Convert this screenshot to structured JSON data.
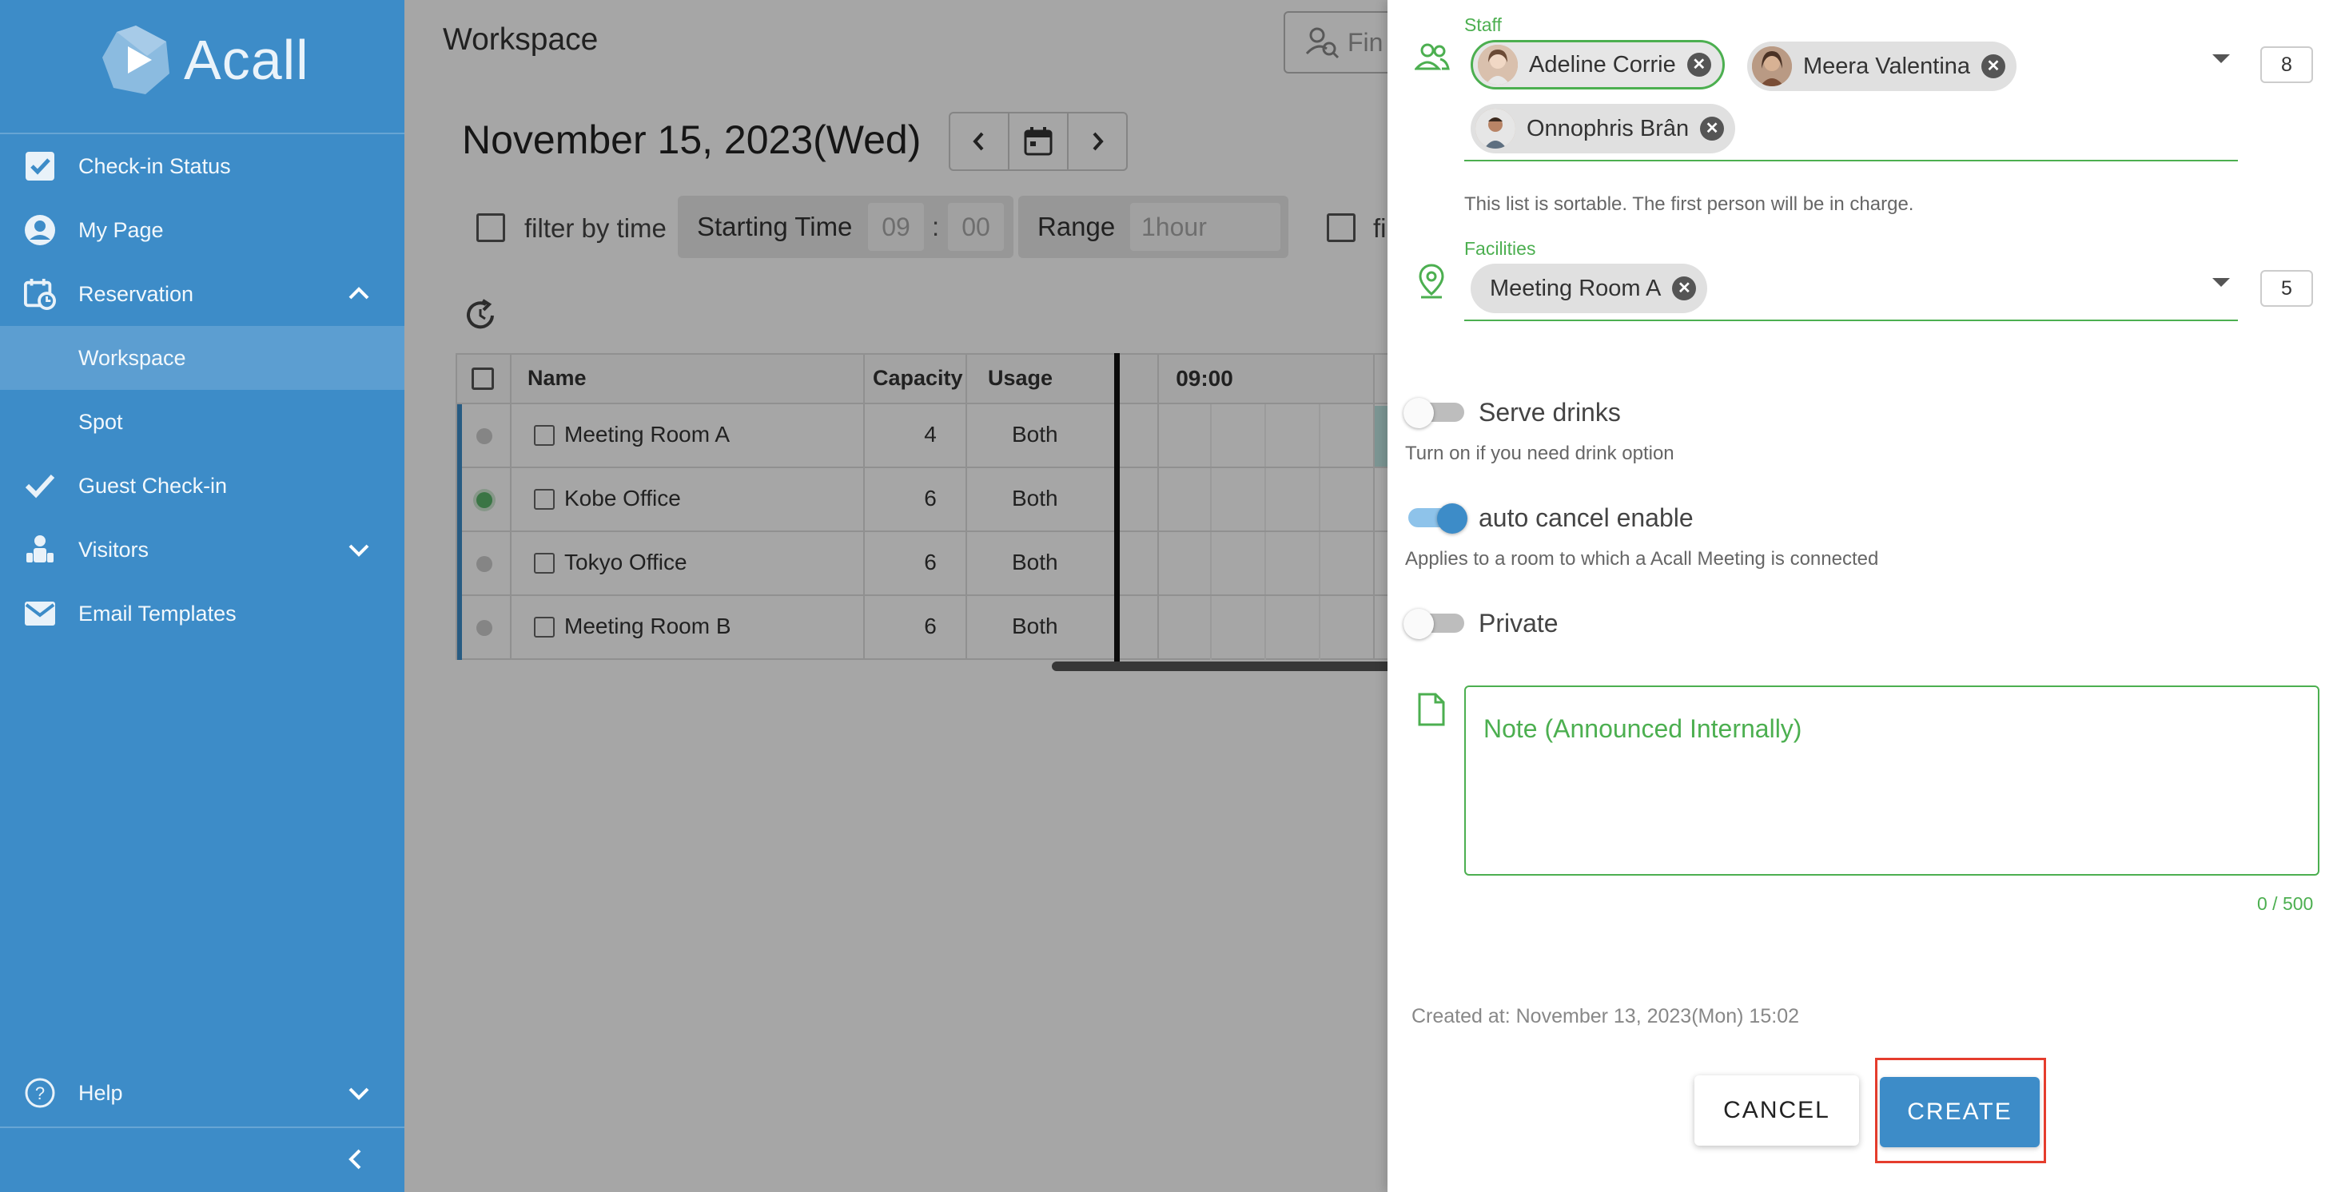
{
  "sidebar": {
    "brand": "Acall",
    "items": [
      {
        "label": "Check-in Status",
        "icon": "check-square-icon"
      },
      {
        "label": "My Page",
        "icon": "account-circle-icon"
      },
      {
        "label": "Reservation",
        "icon": "calendar-clock-icon"
      },
      {
        "label": "Workspace"
      },
      {
        "label": "Spot"
      },
      {
        "label": "Guest Check-in",
        "icon": "checkmark-icon"
      },
      {
        "label": "Visitors",
        "icon": "visitor-icon"
      },
      {
        "label": "Email Templates",
        "icon": "mail-icon"
      }
    ],
    "help": "Help"
  },
  "main": {
    "title": "Workspace",
    "search_placeholder": "Fin",
    "date": "November 15, 2023(Wed)",
    "filter": {
      "filter_by_time": "filter by time",
      "starting_time_label": "Starting Time",
      "hour": "09",
      "sep": ":",
      "minute": "00",
      "range_label": "Range",
      "range_value": "1hour",
      "cut_label": "fi"
    },
    "table": {
      "headers": {
        "name": "Name",
        "capacity": "Capacity",
        "usage": "Usage",
        "time": "09:00"
      },
      "rows": [
        {
          "name": "Meeting Room A",
          "capacity": "4",
          "usage": "Both"
        },
        {
          "name": "Kobe Office",
          "capacity": "6",
          "usage": "Both"
        },
        {
          "name": "Tokyo Office",
          "capacity": "6",
          "usage": "Both"
        },
        {
          "name": "Meeting Room B",
          "capacity": "6",
          "usage": "Both"
        }
      ]
    }
  },
  "panel": {
    "staff_label": "Staff",
    "staff": [
      "Adeline Corrie",
      "Meera Valentina",
      "Onnophris Brân"
    ],
    "staff_count": "8",
    "staff_hint": "This list is sortable. The first person will be in charge.",
    "facilities_label": "Facilities",
    "facilities": [
      "Meeting Room A"
    ],
    "facilities_count": "5",
    "serve_drinks": {
      "label": "Serve drinks",
      "hint": "Turn on if you need drink option",
      "on": false
    },
    "auto_cancel": {
      "label": "auto cancel enable",
      "hint": "Applies to a room to which a Acall Meeting is connected",
      "on": true
    },
    "private": {
      "label": "Private",
      "on": false
    },
    "note_placeholder": "Note (Announced Internally)",
    "note_counter": "0 / 500",
    "created_at": "Created at: November 13, 2023(Mon) 15:02",
    "cancel": "CANCEL",
    "create": "CREATE"
  },
  "colors": {
    "brand": "#3d8cc8",
    "accent_green": "#4caf50",
    "highlight": "#e53d2d"
  }
}
